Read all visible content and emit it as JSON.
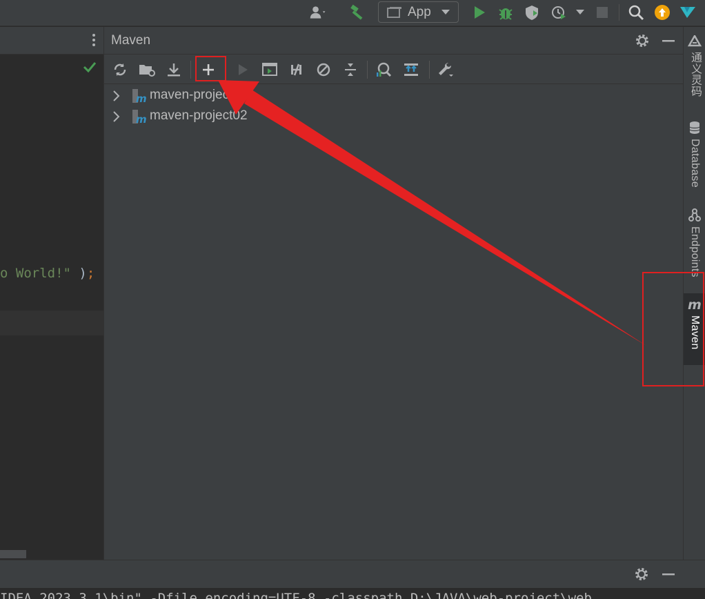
{
  "toolbar": {
    "run_config_label": "App"
  },
  "editor": {
    "code_string": "o World!\"",
    "code_close": " )",
    "code_semicolon": ";"
  },
  "maven": {
    "title": "Maven",
    "projects": [
      {
        "name": "maven-project01"
      },
      {
        "name": "maven-project02"
      }
    ]
  },
  "right_strip": {
    "items": [
      {
        "label": "通义灵码"
      },
      {
        "label": "Database"
      },
      {
        "label": "Endpoints"
      },
      {
        "label": "Maven"
      }
    ]
  },
  "console": {
    "line": " IDEA 2023.3.1\\bin\" -Dfile.encoding=UTF-8 -classpath D:\\JAVA\\web-project\\web"
  },
  "colors": {
    "accent_red": "#e02020",
    "run_green": "#499c54",
    "maven_blue": "#3592c4"
  }
}
